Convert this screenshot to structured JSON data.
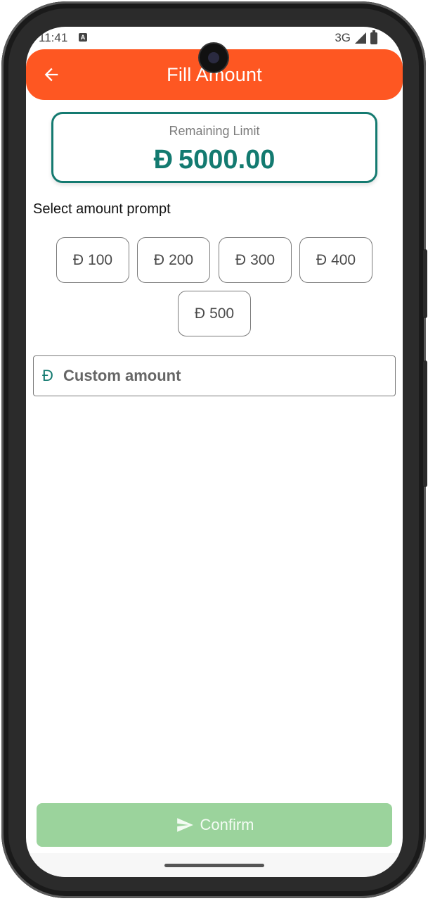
{
  "status_bar": {
    "time": "11:41",
    "notification_badge": "A",
    "network": "3G"
  },
  "app_bar": {
    "title": "Fill Amount",
    "color": "#fe5722"
  },
  "limit_card": {
    "label": "Remaining Limit",
    "currency_symbol": "Ɖ",
    "amount": "5000.00",
    "accent_color": "#137a70"
  },
  "prompt": {
    "label": "Select amount prompt"
  },
  "amount_options": [
    {
      "currency": "Ɖ",
      "value": "100"
    },
    {
      "currency": "Ɖ",
      "value": "200"
    },
    {
      "currency": "Ɖ",
      "value": "300"
    },
    {
      "currency": "Ɖ",
      "value": "400"
    },
    {
      "currency": "Ɖ",
      "value": "500"
    }
  ],
  "custom_amount": {
    "currency_symbol": "Ɖ",
    "placeholder": "Custom amount",
    "value": ""
  },
  "confirm": {
    "label": "Confirm",
    "color": "#9bd39c",
    "icon": "send-icon"
  },
  "icons": {
    "back": "arrow-left-icon",
    "signal": "signal-icon",
    "battery": "battery-icon"
  }
}
